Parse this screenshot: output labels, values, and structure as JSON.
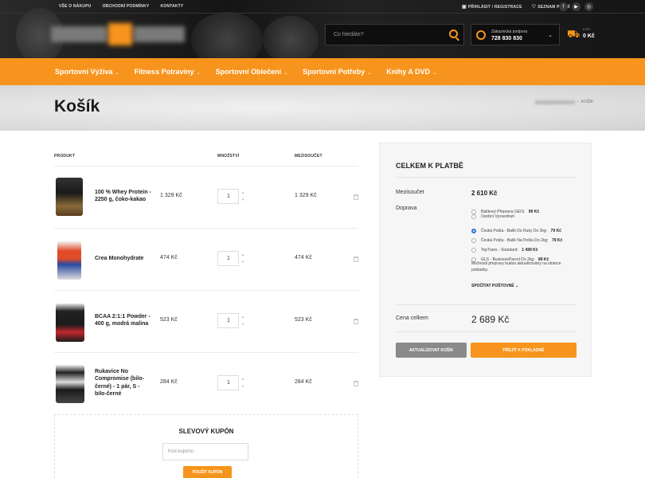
{
  "topbar": {
    "links": [
      "VŠE O NÁKUPU",
      "OBCHODNÍ PODMÍNKY",
      "KONTAKTY"
    ],
    "login": "PŘIHLÁSIT / REGISTRACE",
    "wishlist": "SEZNAM PŘÁNÍ",
    "social": [
      "f",
      "▶",
      "◎"
    ]
  },
  "search": {
    "placeholder": "Co hledáte?"
  },
  "support": {
    "label": "Zákaznická podpora",
    "phone": "728 830 830"
  },
  "cart": {
    "items": "0 KS",
    "total": "0 Kč"
  },
  "nav": [
    "Sportovní Výživa",
    "Fitness Potraviny",
    "Sportovní Oblečení",
    "Sportovní Potřeby",
    "Knihy A DVD"
  ],
  "page": {
    "title": "Košík",
    "breadcrumb_current": "KOŠÍK"
  },
  "table": {
    "headers": {
      "product": "PRODUKT",
      "quantity": "MNOŽSTVÍ",
      "subtotal": "MEZISOUČET"
    },
    "rows": [
      {
        "name": "100 % Whey Protein - 2250 g, čoko-kakao",
        "price": "1 329 Kč",
        "qty": "1",
        "subtotal": "1 329 Kč"
      },
      {
        "name": "Crea Monohydrate",
        "price": "474 Kč",
        "qty": "1",
        "subtotal": "474 Kč"
      },
      {
        "name": "BCAA 2:1:1 Powder - 400 g, modrá malina",
        "price": "523 Kč",
        "qty": "1",
        "subtotal": "523 Kč"
      },
      {
        "name": "Rukavice No Compromise (bilo-černé) - 1 pár, S - bilo-černé",
        "price": "284 Kč",
        "qty": "1",
        "subtotal": "284 Kč"
      }
    ]
  },
  "coupon": {
    "title": "SLEVOVÝ KUPÓN",
    "placeholder": "Kód kupónu",
    "button": "POUŽÍT KUPÓN"
  },
  "totals": {
    "title": "CELKEM K PLATBĚ",
    "subtotal_label": "Mezisoučet",
    "subtotal": "2 610 Kč",
    "shipping_label": "Doprava",
    "shipping": [
      {
        "label": "Balíkový Přeprava GEIS:",
        "price": "99 Kč"
      },
      {
        "label": "Osobní Vyzvednutí",
        "price": ""
      },
      {
        "label": "Česká Pošta - Balík Do Ruky Do 2kg:",
        "price": "79 Kč"
      },
      {
        "label": "Česká Pošta - Balík Na Poštu Do 2kg:",
        "price": "79 Kč"
      },
      {
        "label": "TopTrans - Standard:",
        "price": "1 499 Kč"
      },
      {
        "label": "GLS - BusinessParcel Do 2kg:",
        "price": "89 Kč"
      }
    ],
    "shipping_note": "Možnosti přepravy budou aktualizovány na stránce pokladny.",
    "calc_label": "SPOČÍTAT POŠTOVNÉ",
    "total_label": "Cena celkem",
    "total": "2 689 Kč",
    "update_button": "AKTUALIZOVAT KOŠÍK",
    "checkout_button": "PŘEJÍT K POKLADNĚ"
  },
  "colors": {
    "accent": "#f7941d",
    "dark": "#1b1b1b",
    "radio_selected": "#2f6fe0"
  }
}
